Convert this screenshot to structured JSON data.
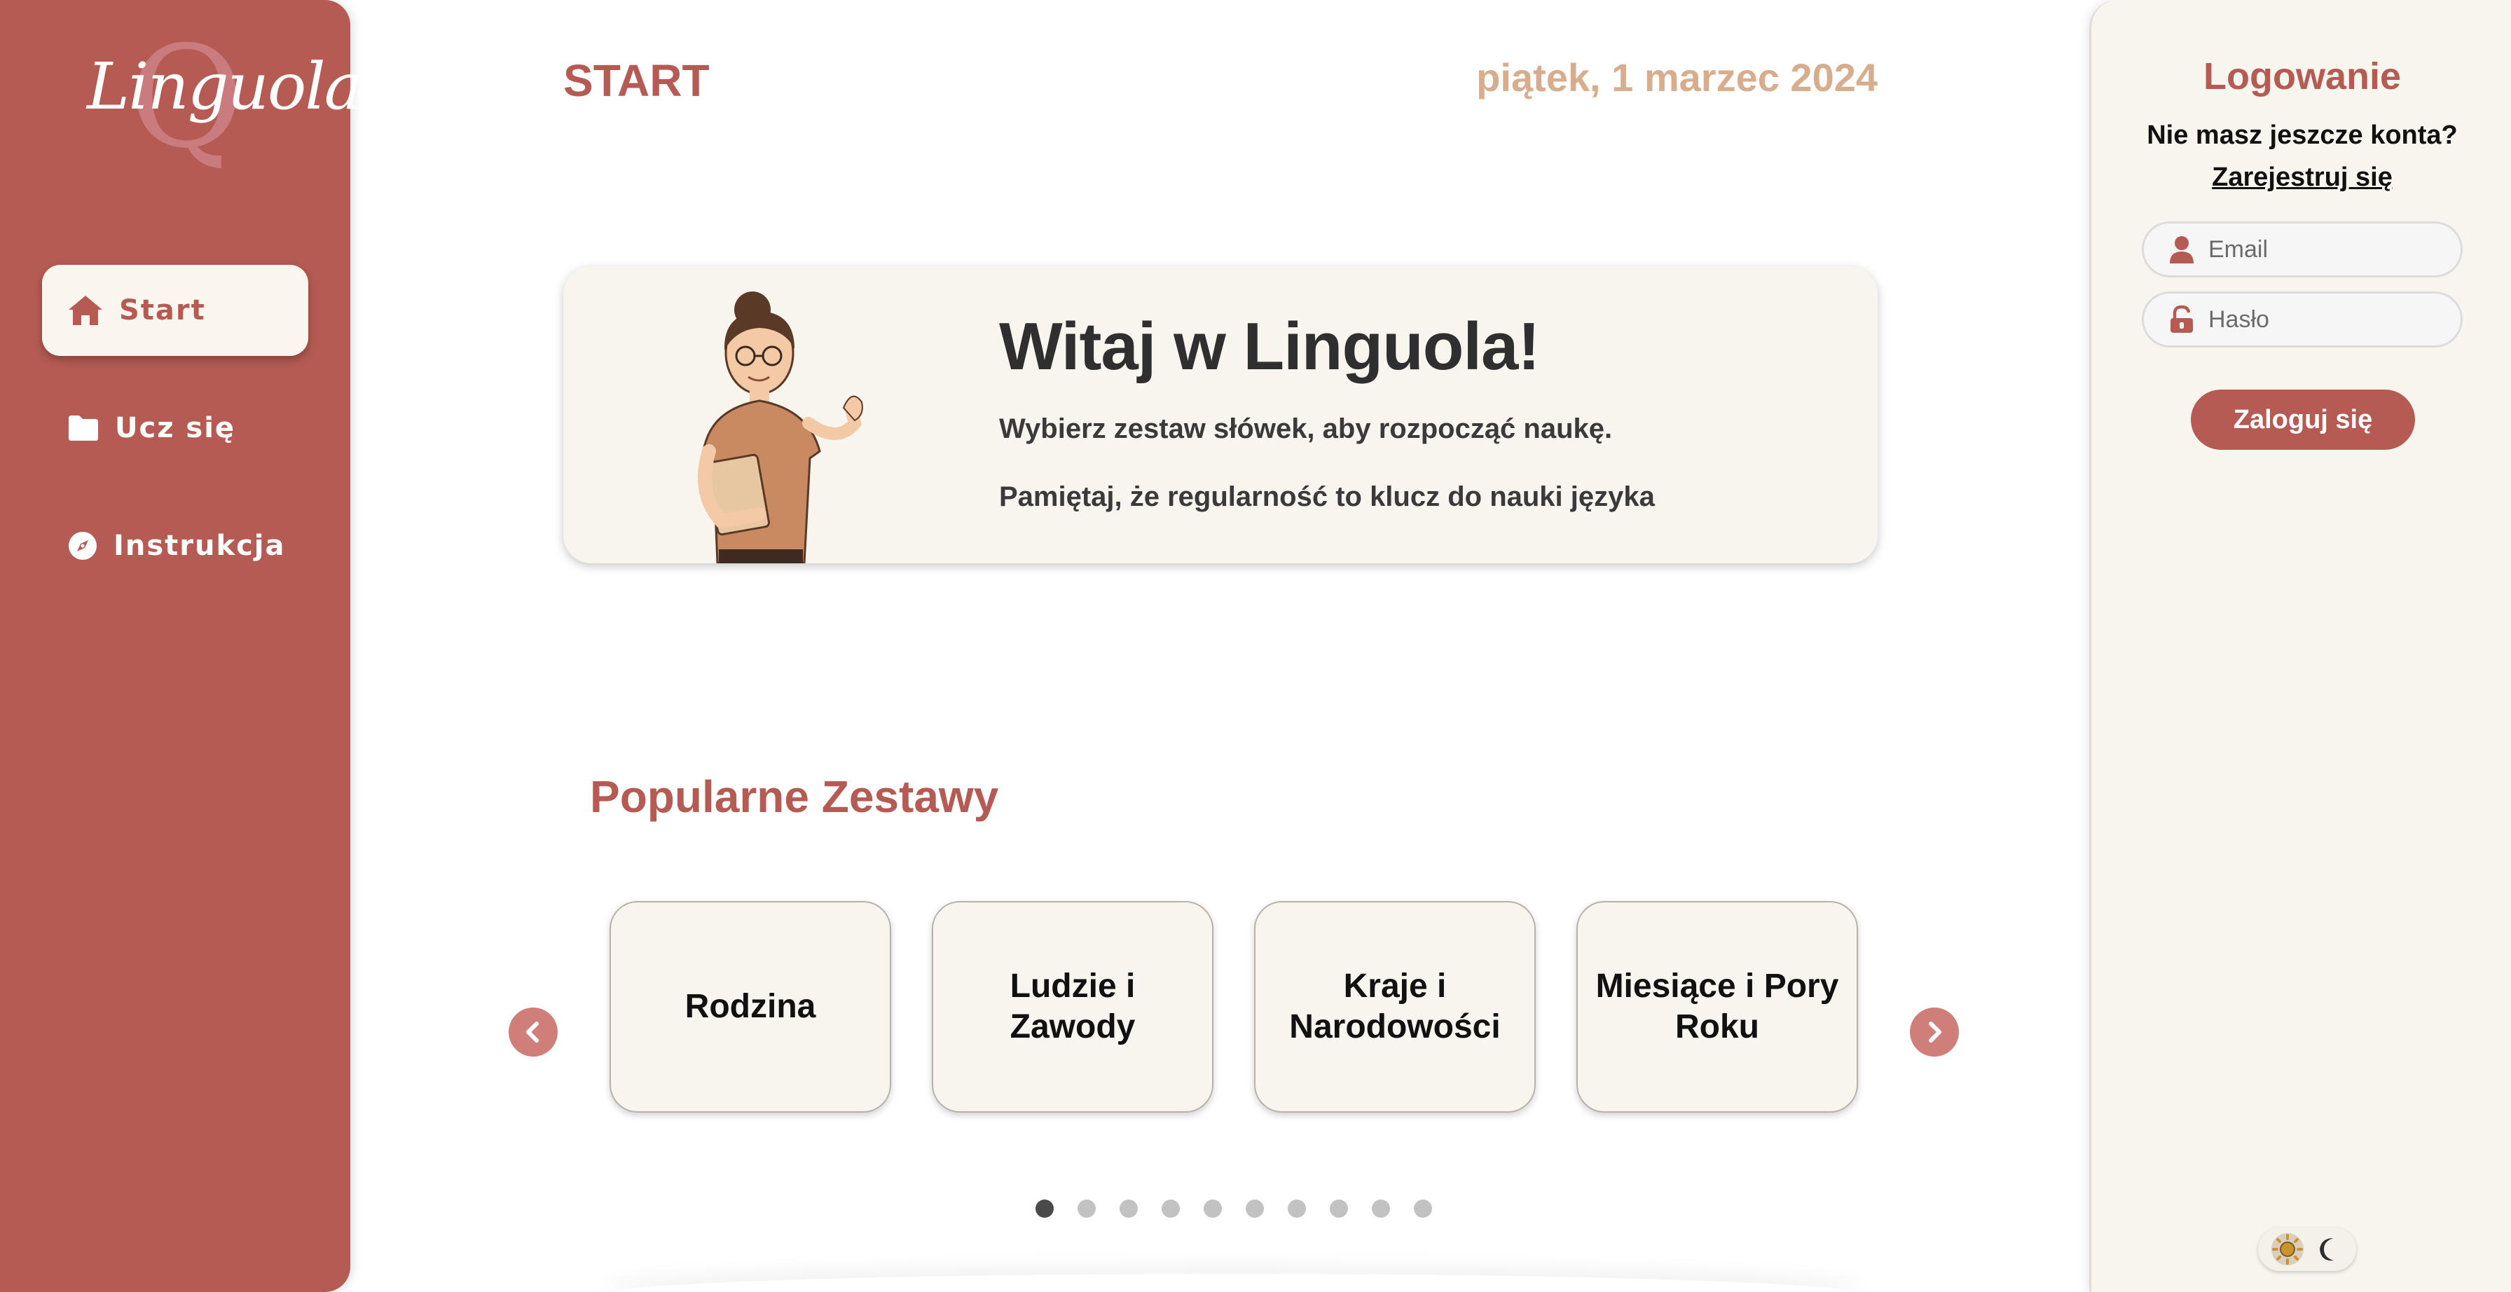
{
  "app": {
    "logo_text": "Linguola",
    "logo_letter": "Q"
  },
  "sidebar": {
    "items": [
      {
        "label": "Start",
        "icon": "home-icon",
        "active": true
      },
      {
        "label": "Ucz się",
        "icon": "folder-icon",
        "active": false
      },
      {
        "label": "Instrukcja",
        "icon": "compass-icon",
        "active": false
      }
    ]
  },
  "header": {
    "title": "START",
    "date": "piątek, 1 marzec 2024"
  },
  "welcome": {
    "heading": "Witaj w Linguola!",
    "line1": "Wybierz zestaw słówek, aby rozpocząć naukę.",
    "line2": "Pamiętaj, że regularność to klucz do nauki języka"
  },
  "popular": {
    "title": "Popularne Zestawy",
    "cards": [
      "Rodzina",
      "Ludzie i Zawody",
      "Kraje i Narodowości",
      "Miesiące i Pory Roku"
    ],
    "dots_count": 10,
    "active_dot": 0
  },
  "login": {
    "title": "Logowanie",
    "no_account": "Nie masz jeszcze konta?",
    "register_link": "Zarejestruj się",
    "email_placeholder": "Email",
    "password_placeholder": "Hasło",
    "submit_label": "Zaloguj się"
  },
  "colors": {
    "brand": "#b55b53",
    "panel": "#f8f5ee",
    "date": "#d8ad8d",
    "arrow": "#cf7e7a"
  }
}
